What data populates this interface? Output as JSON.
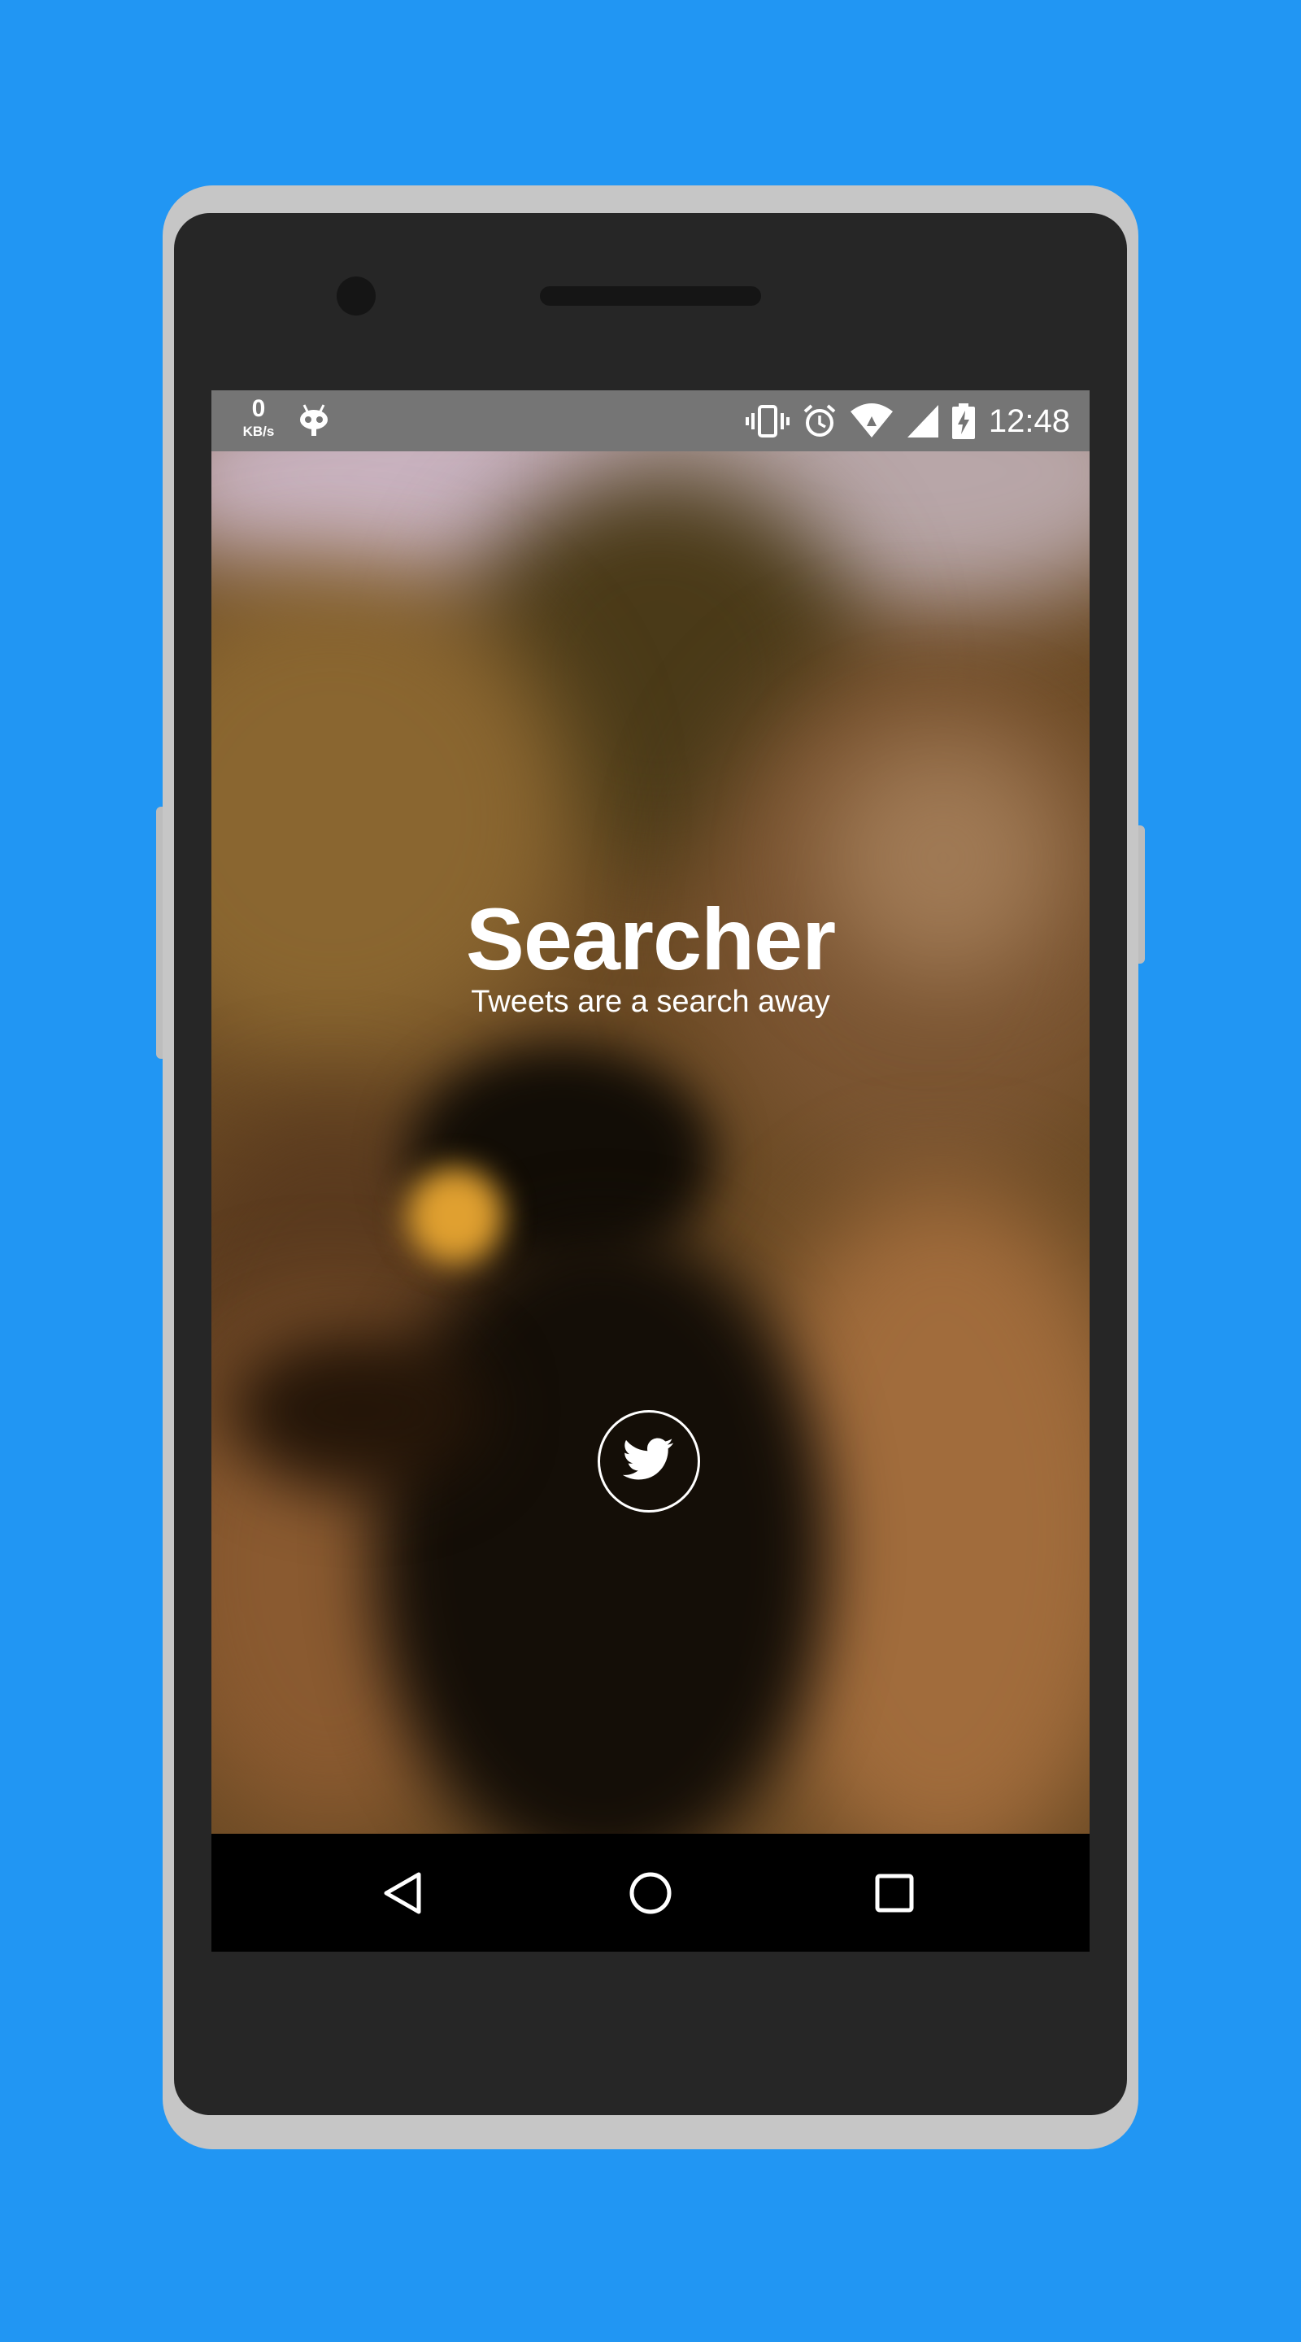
{
  "status_bar": {
    "net_speed_value": "0",
    "net_speed_unit": "KB/s",
    "time": "12:48",
    "icons": [
      "vibrate-icon",
      "alarm-icon",
      "wifi-icon",
      "signal-icon",
      "battery-charging-icon"
    ],
    "background": "#757575"
  },
  "app": {
    "title": "Searcher",
    "subtitle": "Tweets are a search away",
    "login_icon": "twitter-bird-icon"
  },
  "navigation_bar": {
    "buttons": [
      "back-icon",
      "home-icon",
      "recents-icon"
    ]
  },
  "colors": {
    "page_background": "#2196F3",
    "phone_frame": "#c6c6c6",
    "phone_body": "#262626",
    "text": "#ffffff"
  }
}
